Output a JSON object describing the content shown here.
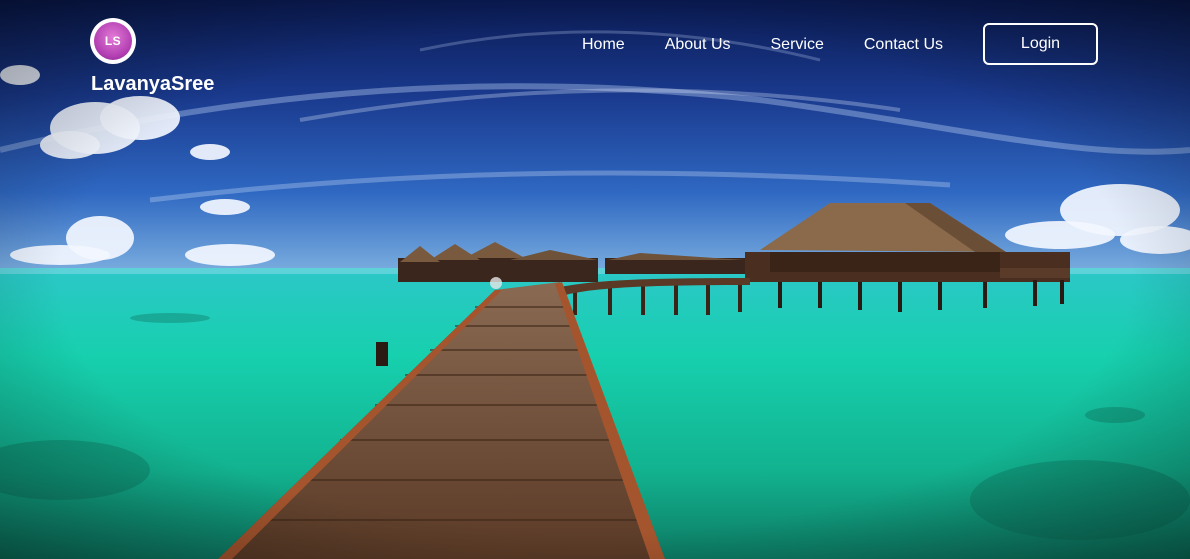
{
  "brand": {
    "logo_text": "LS",
    "name": "LavanyaSree"
  },
  "nav": {
    "items": [
      {
        "label": "Home"
      },
      {
        "label": "About Us"
      },
      {
        "label": "Service"
      },
      {
        "label": "Contact Us"
      }
    ],
    "login_label": "Login"
  },
  "hero": {
    "icon": "tropical-overwater-villa-photo",
    "colors": {
      "sky_dark": "#0d1f5c",
      "sky_light": "#2a5db8",
      "water": "#18c9b0",
      "boardwalk": "#6b4a33",
      "roof": "#8a6a4a"
    }
  }
}
